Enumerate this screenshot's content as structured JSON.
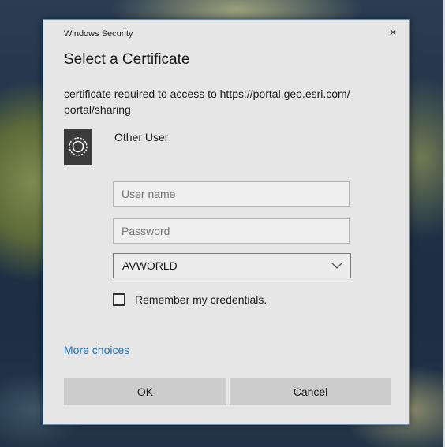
{
  "window": {
    "title": "Windows Security",
    "close_glyph": "×"
  },
  "dialog": {
    "heading": "Select a Certificate",
    "message": "certificate required to access to https://portal.geo.esri.com/\nportal/sharing"
  },
  "account": {
    "icon": "certificate-icon",
    "name": "Other User"
  },
  "form": {
    "username_placeholder": "User name",
    "username_value": "",
    "password_placeholder": "Password",
    "password_value": "",
    "domain_selected": "AVWORLD",
    "remember_label": "Remember my credentials.",
    "remember_checked": false
  },
  "links": {
    "more_choices": "More choices"
  },
  "buttons": {
    "ok": "OK",
    "cancel": "Cancel"
  },
  "colors": {
    "dialog_bg": "#e6e6e6",
    "link": "#1f6fb5",
    "button_bg": "#cccccc",
    "tile_bg": "#3b3b3b"
  }
}
